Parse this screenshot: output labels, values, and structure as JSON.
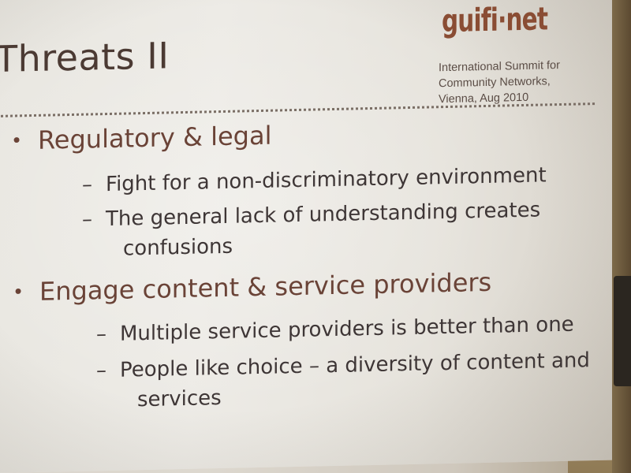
{
  "slide": {
    "title": "Threats II",
    "logo": "guifi·net",
    "event": {
      "line1": "International Summit for",
      "line2": "Community Networks,",
      "line3": "Vienna, Aug 2010"
    },
    "bullets": [
      {
        "text": "Regulatory & legal",
        "subs": [
          {
            "line1": "Fight for a non-discriminatory environment",
            "line2": ""
          },
          {
            "line1": "The general lack of understanding creates",
            "line2": "confusions"
          }
        ]
      },
      {
        "text": "Engage content & service providers",
        "subs": [
          {
            "line1": "Multiple service providers is better than one",
            "line2": ""
          },
          {
            "line1": "People like choice – a diversity of content and",
            "line2": "services"
          }
        ]
      }
    ]
  },
  "colors": {
    "logo": "#8a4d34",
    "bullet_text": "#6a4337",
    "sub_text": "#3e3636",
    "title": "#4b3a33"
  }
}
